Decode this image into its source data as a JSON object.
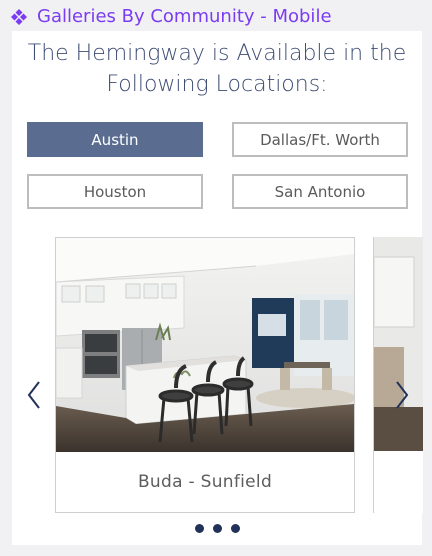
{
  "header": {
    "label": "Galleries By Community - Mobile",
    "icon": "component-diamond-icon",
    "color": "#7a3cf2"
  },
  "gallery": {
    "title": "The Hemingway is Available in the Following Locations:",
    "locations": [
      {
        "label": "Austin",
        "active": true
      },
      {
        "label": "Dallas/Ft. Worth",
        "active": false
      },
      {
        "label": "Houston",
        "active": false
      },
      {
        "label": "San Antonio",
        "active": false
      }
    ],
    "active_color": "#5a6d90",
    "cards": [
      {
        "caption": "Buda - Sunfield",
        "image": "kitchen-dining-interior-photo"
      }
    ],
    "pagination": {
      "dots": 3
    }
  }
}
